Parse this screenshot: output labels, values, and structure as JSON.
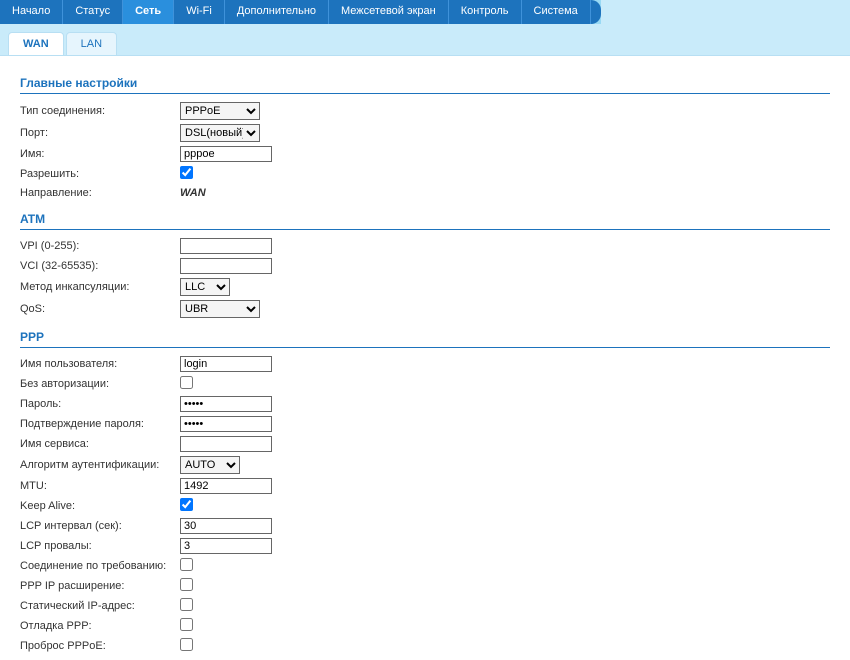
{
  "nav": {
    "items": [
      "Начало",
      "Статус",
      "Сеть",
      "Wi-Fi",
      "Дополнительно",
      "Межсетевой экран",
      "Контроль",
      "Система"
    ],
    "active": 2
  },
  "subnav": {
    "items": [
      "WAN",
      "LAN"
    ],
    "active": 0
  },
  "sections": {
    "main": {
      "title": "Главные настройки",
      "conn_type_label": "Тип соединения:",
      "conn_type_value": "PPPoE",
      "port_label": "Порт:",
      "port_value": "DSL(новый)",
      "name_label": "Имя:",
      "name_value": "pppoe",
      "allow_label": "Разрешить:",
      "allow_checked": true,
      "direction_label": "Направление:",
      "direction_value": "WAN"
    },
    "atm": {
      "title": "ATM",
      "vpi_label": "VPI (0-255):",
      "vpi_value": "",
      "vci_label": "VCI (32-65535):",
      "vci_value": "",
      "encaps_label": "Метод инкапсуляции:",
      "encaps_value": "LLC",
      "qos_label": "QoS:",
      "qos_value": "UBR"
    },
    "ppp": {
      "title": "PPP",
      "user_label": "Имя пользователя:",
      "user_value": "login",
      "noauth_label": "Без авторизации:",
      "noauth_checked": false,
      "pass_label": "Пароль:",
      "pass_value": "•••••",
      "pass2_label": "Подтверждение пароля:",
      "pass2_value": "•••••",
      "service_label": "Имя сервиса:",
      "service_value": "",
      "auth_algo_label": "Алгоритм аутентификации:",
      "auth_algo_value": "AUTO",
      "mtu_label": "MTU:",
      "mtu_value": "1492",
      "keepalive_label": "Keep Alive:",
      "keepalive_checked": true,
      "lcp_interval_label": "LCP интервал (сек):",
      "lcp_interval_value": "30",
      "lcp_fail_label": "LCP провалы:",
      "lcp_fail_value": "3",
      "dial_on_demand_label": "Соединение по требованию:",
      "dial_on_demand_checked": false,
      "ppp_ip_ext_label": "PPP IP расширение:",
      "ppp_ip_ext_checked": false,
      "static_ip_label": "Статический IP-адрес:",
      "static_ip_checked": false,
      "ppp_debug_label": "Отладка PPP:",
      "ppp_debug_checked": false,
      "pppoe_passthrough_label": "Проброс PPPoE:",
      "pppoe_passthrough_checked": false
    }
  }
}
